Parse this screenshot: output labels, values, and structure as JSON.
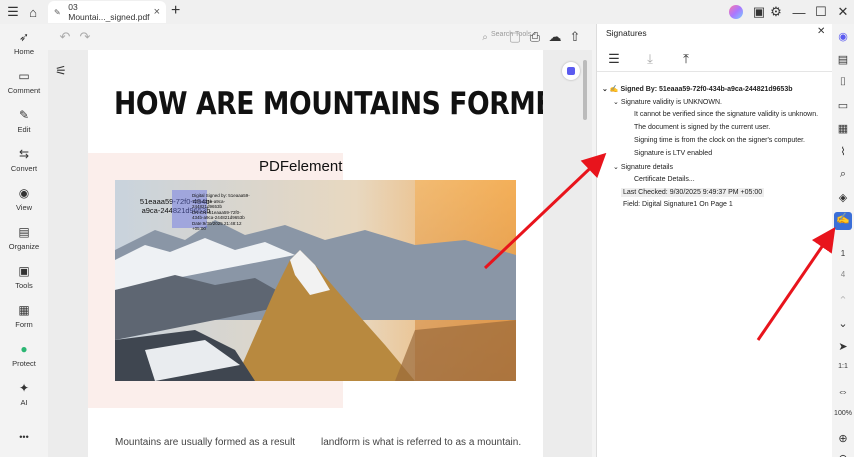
{
  "titlebar": {
    "tab_title": "03 Mountai..._signed.pdf",
    "new_tab": "+"
  },
  "sidebar": {
    "items": [
      {
        "label": "Home"
      },
      {
        "label": "Comment"
      },
      {
        "label": "Edit"
      },
      {
        "label": "Convert"
      },
      {
        "label": "View"
      },
      {
        "label": "Organize"
      },
      {
        "label": "Tools"
      },
      {
        "label": "Form"
      },
      {
        "label": "Protect"
      },
      {
        "label": "AI"
      }
    ],
    "more": "•••"
  },
  "toolbar": {
    "search_label": "Search Tools"
  },
  "document": {
    "heading": "HOW ARE MOUNTAINS FORMED?",
    "image_caption": "PDFelement",
    "signature_name": "51eaaa59-72f0-434b-a9ca-244821d9653b",
    "signature_details": "Digital Signed by: 51eaaa59-72f0-434b-a9ca-244821d9653b DN:CN=51eaaa59-72f0-434b-a9ca-244821d9653b Date:9/30/2025 21:48:12 +05:00",
    "body_left": "Mountains are usually formed as a result",
    "body_right": "landform is what is referred to as a mountain."
  },
  "signatures_panel": {
    "title": "Signatures",
    "signed_by": "Signed By: 51eaaa59-72f0-434b-a9ca-244821d9653b",
    "validity": "Signature validity is UNKNOWN.",
    "validity_items": [
      "It cannot be verified since the signature validity is unknown.",
      "The document is signed by the current user.",
      "Signing time is from the clock on the signer's computer.",
      "Signature is LTV enabled"
    ],
    "details": "Signature details",
    "certificate": "Certificate Details...",
    "last_checked": "Last Checked: 9/30/2025 9:49:37 PM +05:00",
    "field": "Field: Digital Signature1 On Page 1"
  },
  "rightbar": {
    "page_current": "1",
    "page_total": "4",
    "zoom": "100%"
  }
}
